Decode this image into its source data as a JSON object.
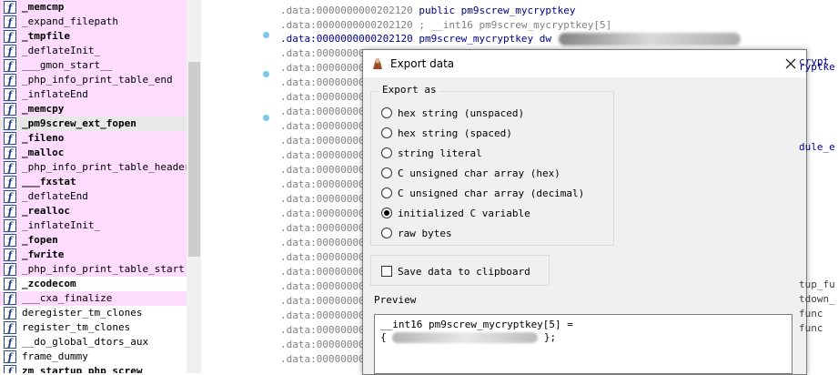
{
  "functions": [
    {
      "name": "_memcmp",
      "bold": true,
      "pink": true
    },
    {
      "name": "_expand_filepath",
      "bold": false,
      "pink": true
    },
    {
      "name": "_tmpfile",
      "bold": true,
      "pink": true
    },
    {
      "name": "_deflateInit_",
      "bold": false,
      "pink": true
    },
    {
      "name": "___gmon_start__",
      "bold": false,
      "pink": true
    },
    {
      "name": "_php_info_print_table_end",
      "bold": false,
      "pink": true
    },
    {
      "name": "_inflateEnd",
      "bold": false,
      "pink": true
    },
    {
      "name": "_memcpy",
      "bold": true,
      "pink": true
    },
    {
      "name": "_pm9screw_ext_fopen",
      "bold": true,
      "pink": false,
      "selected": true
    },
    {
      "name": "_fileno",
      "bold": true,
      "pink": true
    },
    {
      "name": "_malloc",
      "bold": true,
      "pink": true
    },
    {
      "name": "_php_info_print_table_header",
      "bold": false,
      "pink": true
    },
    {
      "name": "___fxstat",
      "bold": true,
      "pink": true
    },
    {
      "name": "_deflateEnd",
      "bold": false,
      "pink": true
    },
    {
      "name": "_realloc",
      "bold": true,
      "pink": true
    },
    {
      "name": "_inflateInit_",
      "bold": false,
      "pink": true
    },
    {
      "name": "_fopen",
      "bold": true,
      "pink": true
    },
    {
      "name": "_fwrite",
      "bold": true,
      "pink": true
    },
    {
      "name": "_php_info_print_table_start",
      "bold": false,
      "pink": true
    },
    {
      "name": "_zcodecom",
      "bold": true,
      "pink": false
    },
    {
      "name": "___cxa_finalize",
      "bold": false,
      "pink": true
    },
    {
      "name": "deregister_tm_clones",
      "bold": false,
      "pink": false
    },
    {
      "name": "register_tm_clones",
      "bold": false,
      "pink": false
    },
    {
      "name": "__do_global_dtors_aux",
      "bold": false,
      "pink": false
    },
    {
      "name": "frame_dummy",
      "bold": false,
      "pink": false
    },
    {
      "name": "zm_startup_php_screw",
      "bold": true,
      "pink": false
    }
  ],
  "disasm": {
    "line0": ".data:0000000000202120",
    "line0_code": "public pm9screw_mycryptkey",
    "line1": ".data:0000000000202120 ; __int16 pm9screw_mycryptkey[5]",
    "line2": ".data:0000000000202120 pm9screw_mycryptkey dw",
    "addr_prefix": ".data:00000000",
    "right_frags": [
      "crypt",
      "ryptke",
      "dule_e",
      "tup_fu",
      "tdown_",
      "func",
      "func",
      "func"
    ]
  },
  "dialog": {
    "title": "Export data",
    "export_as_label": "Export as",
    "options": [
      {
        "label": "hex string (unspaced)",
        "checked": false
      },
      {
        "label": "hex string (spaced)",
        "checked": false
      },
      {
        "label": "string literal",
        "checked": false
      },
      {
        "label": "C unsigned char array (hex)",
        "checked": false
      },
      {
        "label": "C unsigned char array (decimal)",
        "checked": false
      },
      {
        "label": "initialized C variable",
        "checked": true
      },
      {
        "label": "raw bytes",
        "checked": false
      }
    ],
    "clipboard_label": "Save data to clipboard",
    "preview_label": "Preview",
    "preview_line1": "__int16 pm9screw_mycryptkey[5] =",
    "preview_line2_start": "{",
    "preview_line2_end": "};"
  }
}
